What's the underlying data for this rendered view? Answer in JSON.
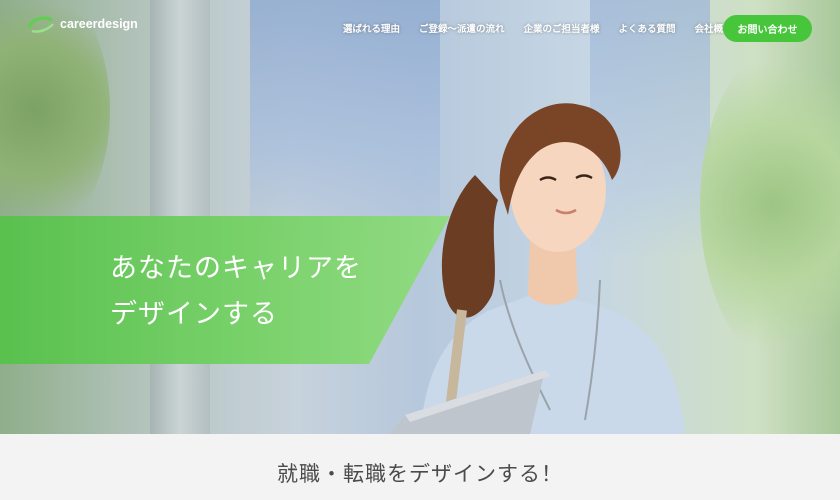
{
  "header": {
    "logo_text": "careerdesign",
    "nav": [
      {
        "label": "選ばれる理由"
      },
      {
        "label": "ご登録～派遣の流れ"
      },
      {
        "label": "企業のご担当者様"
      },
      {
        "label": "よくある質問"
      },
      {
        "label": "会社概要"
      }
    ],
    "cta_label": "お問い合わせ"
  },
  "hero": {
    "line1": "あなたのキャリアを",
    "line2": "デザインする"
  },
  "section": {
    "title": "就職・転職をデザインする！"
  },
  "colors": {
    "accent": "#47c63c",
    "banner": "#6ccd5c"
  }
}
